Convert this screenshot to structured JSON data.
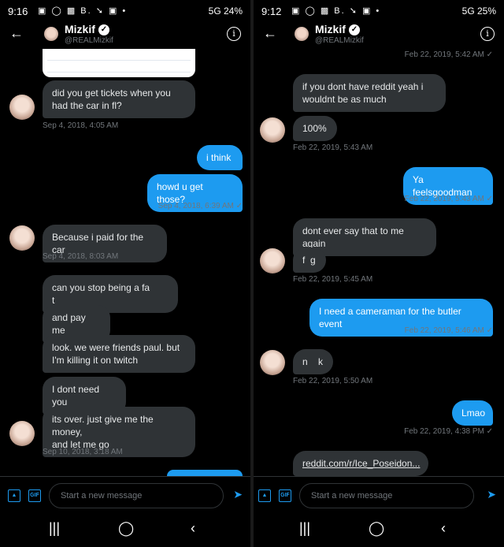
{
  "left": {
    "status": {
      "time": "9:16",
      "right": "5G 24%"
    },
    "header": {
      "name": "Mizkif",
      "handle": "@REALMizkif"
    },
    "messages": [
      {
        "text": "did you get tickets when you\nhad the car in fl?"
      },
      {
        "text": "i think"
      },
      {
        "text": "howd u get those?"
      },
      {
        "text": "Because i paid for the car"
      },
      {
        "text": "can you stop being a fa       t"
      },
      {
        "text": "and pay me"
      },
      {
        "text": "look. we were friends paul. but\nI'm killing it on twitch"
      },
      {
        "text": "I dont need you"
      },
      {
        "text": "its over. just give me the money,\nand let me go"
      }
    ],
    "timestamps": [
      "Sep 4, 2018, 4:05 AM",
      "Sep 4, 2018, 6:39 AM ✓",
      "Sep 4, 2018, 8:03 AM",
      "Sep 10, 2018, 3:18 AM"
    ],
    "composer_placeholder": "Start a new message"
  },
  "right": {
    "status": {
      "time": "9:12",
      "right": "5G 25%"
    },
    "header": {
      "name": "Mizkif",
      "handle": "@REALMizkif"
    },
    "messages": [
      {
        "text": "if you dont have reddit yeah i\nwouldnt be as much"
      },
      {
        "text": "100%"
      },
      {
        "text": "Ya feelsgoodman"
      },
      {
        "text": "dont ever say that to me again"
      },
      {
        "text": "f  g"
      },
      {
        "text": "I need a cameraman for the butler event"
      },
      {
        "text": "n    k"
      },
      {
        "text": "Lmao"
      },
      {
        "text": "reddit.com/r/Ice_Poseidon..."
      }
    ],
    "timestamps": [
      "Feb 22, 2019, 5:42 AM ✓",
      "Feb 22, 2019, 5:43 AM",
      "Feb 22, 2019, 5:43 AM ✓",
      "Feb 22, 2019, 5:45 AM",
      "Feb 22, 2019, 5:46 AM ✓",
      "Feb 22, 2019, 5:50 AM",
      "Feb 22, 2019, 4:38 PM ✓"
    ],
    "composer_placeholder": "Start a new message"
  },
  "icons": {
    "back": "back-arrow-icon",
    "info": "info-icon",
    "image": "image-icon",
    "gif": "gif-icon",
    "send": "send-icon"
  },
  "gif_label": "GIF",
  "colors": {
    "accent": "#1d9bf0",
    "bubble_in": "#2f3336",
    "background": "#000000"
  }
}
